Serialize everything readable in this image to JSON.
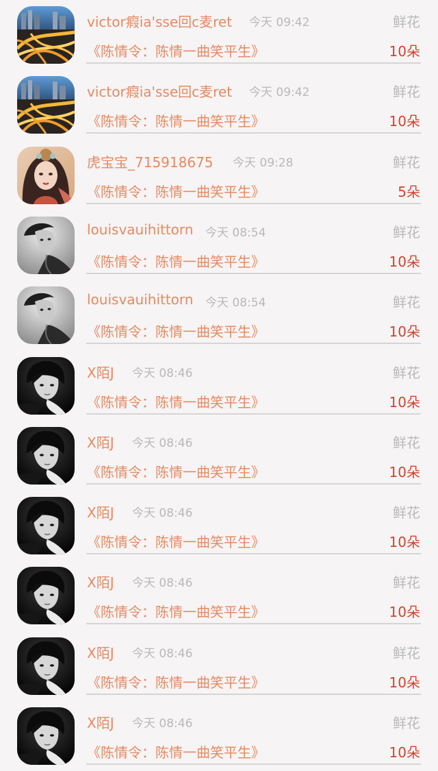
{
  "entries": [
    {
      "name": "victor瘕ia'sse回c麦ret",
      "time": "今天 09:42",
      "gift": "鲜花",
      "drama": "《陈情令：陈情一曲笑平生》",
      "count": "10朵",
      "avatar_icon": "city-highway-avatar"
    },
    {
      "name": "victor瘕ia'sse回c麦ret",
      "time": "今天 09:42",
      "gift": "鲜花",
      "drama": "《陈情令：陈情一曲笑平生》",
      "count": "10朵",
      "avatar_icon": "city-highway-avatar"
    },
    {
      "name": "虎宝宝_715918675",
      "time": "今天 09:28",
      "gift": "鲜花",
      "drama": "《陈情令：陈情一曲笑平生》",
      "count": "5朵",
      "avatar_icon": "painted-girl-avatar"
    },
    {
      "name": "louisvauihittorn",
      "time": "今天 08:54",
      "gift": "鲜花",
      "drama": "《陈情令：陈情一曲笑平生》",
      "count": "10朵",
      "avatar_icon": "grayscale-man-avatar"
    },
    {
      "name": "louisvauihittorn",
      "time": "今天 08:54",
      "gift": "鲜花",
      "drama": "《陈情令：陈情一曲笑平生》",
      "count": "10朵",
      "avatar_icon": "grayscale-man-avatar"
    },
    {
      "name": "X陌J",
      "time": "今天 08:46",
      "gift": "鲜花",
      "drama": "《陈情令：陈情一曲笑平生》",
      "count": "10朵",
      "avatar_icon": "dark-portrait-avatar"
    },
    {
      "name": "X陌J",
      "time": "今天 08:46",
      "gift": "鲜花",
      "drama": "《陈情令：陈情一曲笑平生》",
      "count": "10朵",
      "avatar_icon": "dark-portrait-avatar"
    },
    {
      "name": "X陌J",
      "time": "今天 08:46",
      "gift": "鲜花",
      "drama": "《陈情令：陈情一曲笑平生》",
      "count": "10朵",
      "avatar_icon": "dark-portrait-avatar"
    },
    {
      "name": "X陌J",
      "time": "今天 08:46",
      "gift": "鲜花",
      "drama": "《陈情令：陈情一曲笑平生》",
      "count": "10朵",
      "avatar_icon": "dark-portrait-avatar"
    },
    {
      "name": "X陌J",
      "time": "今天 08:46",
      "gift": "鲜花",
      "drama": "《陈情令：陈情一曲笑平生》",
      "count": "10朵",
      "avatar_icon": "dark-portrait-avatar"
    },
    {
      "name": "X陌J",
      "time": "今天 08:46",
      "gift": "鲜花",
      "drama": "《陈情令：陈情一曲笑平生》",
      "count": "10朵",
      "avatar_icon": "dark-portrait-avatar"
    }
  ],
  "colors": {
    "background": "#f6f4f5",
    "name_text": "#e58a62",
    "muted_text": "#b9b9b9",
    "count_text": "#d2432c",
    "divider": "#d6d4d5"
  }
}
